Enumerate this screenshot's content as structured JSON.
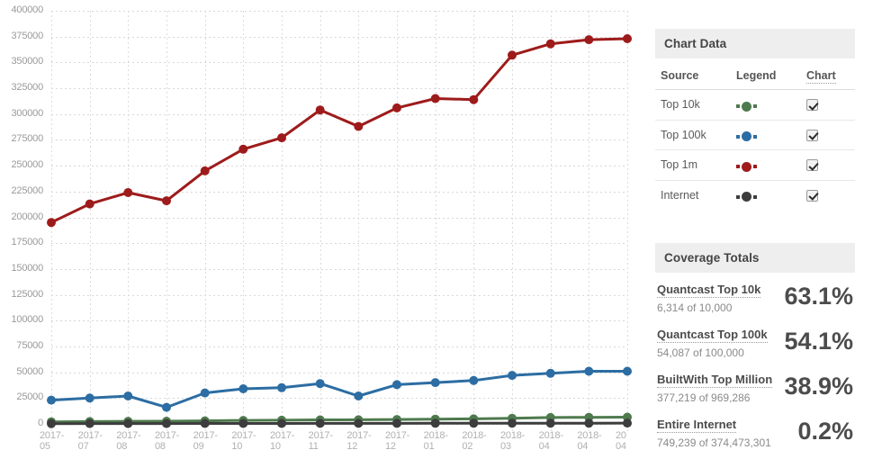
{
  "chart_data": {
    "type": "line",
    "title": "",
    "xlabel": "",
    "ylabel": "",
    "ylim": [
      0,
      400000
    ],
    "grid": true,
    "legend_position": "right-panel",
    "ytick_labels": [
      "400000",
      "375000",
      "350000",
      "325000",
      "300000",
      "275000",
      "250000",
      "225000",
      "200000",
      "175000",
      "150000",
      "125000",
      "100000",
      "75000",
      "50000",
      "25000",
      "0"
    ],
    "ytick_values": [
      400000,
      375000,
      350000,
      325000,
      300000,
      275000,
      250000,
      225000,
      200000,
      175000,
      150000,
      125000,
      100000,
      75000,
      50000,
      25000,
      0
    ],
    "categories": [
      "2017-05",
      "2017-07",
      "2017-08",
      "2017-08",
      "2017-09",
      "2017-10",
      "2017-10",
      "2017-11",
      "2017-12",
      "2017-12",
      "2018-01",
      "2018-02",
      "2018-03",
      "2018-04",
      "2018-04",
      "20 04"
    ],
    "series": [
      {
        "name": "Top 1m",
        "color": "#9e1b1b",
        "values": [
          195000,
          213000,
          224000,
          216000,
          245000,
          266000,
          277000,
          304000,
          288000,
          306000,
          315000,
          314000,
          357000,
          368000,
          372000,
          373000
        ]
      },
      {
        "name": "Top 100k",
        "color": "#2c6da3",
        "values": [
          23000,
          25000,
          27000,
          16000,
          30000,
          34000,
          35000,
          39000,
          27000,
          38000,
          40000,
          42000,
          47000,
          49000,
          51000,
          51000
        ]
      },
      {
        "name": "Top 10k",
        "color": "#4e7a4e",
        "values": [
          2000,
          2300,
          2500,
          2600,
          3000,
          3400,
          3600,
          3900,
          4000,
          4300,
          4600,
          4900,
          5400,
          6200,
          6400,
          6500
        ]
      },
      {
        "name": "Internet",
        "color": "#3d3d3d",
        "values": [
          300,
          320,
          340,
          360,
          400,
          430,
          460,
          490,
          520,
          550,
          590,
          620,
          660,
          700,
          730,
          749
        ]
      }
    ]
  },
  "chart_data_panel": {
    "header": "Chart Data",
    "columns": {
      "source": "Source",
      "legend": "Legend",
      "chart": "Chart"
    },
    "rows": [
      {
        "source": "Top 10k",
        "color": "#4e7a4e",
        "checked": true
      },
      {
        "source": "Top 100k",
        "color": "#2c6da3",
        "checked": true
      },
      {
        "source": "Top 1m",
        "color": "#9e1b1b",
        "checked": true
      },
      {
        "source": "Internet",
        "color": "#3d3d3d",
        "checked": true
      }
    ]
  },
  "coverage_totals": {
    "header": "Coverage Totals",
    "rows": [
      {
        "title": "Quantcast Top 10k",
        "sub": "6,314 of 10,000",
        "pct": "63.1%"
      },
      {
        "title": "Quantcast Top 100k",
        "sub": "54,087 of 100,000",
        "pct": "54.1%"
      },
      {
        "title": "BuiltWith Top Million",
        "sub": "377,219 of 969,286",
        "pct": "38.9%"
      },
      {
        "title": "Entire Internet",
        "sub": "749,239 of 374,473,301",
        "pct": "0.2%"
      }
    ]
  }
}
